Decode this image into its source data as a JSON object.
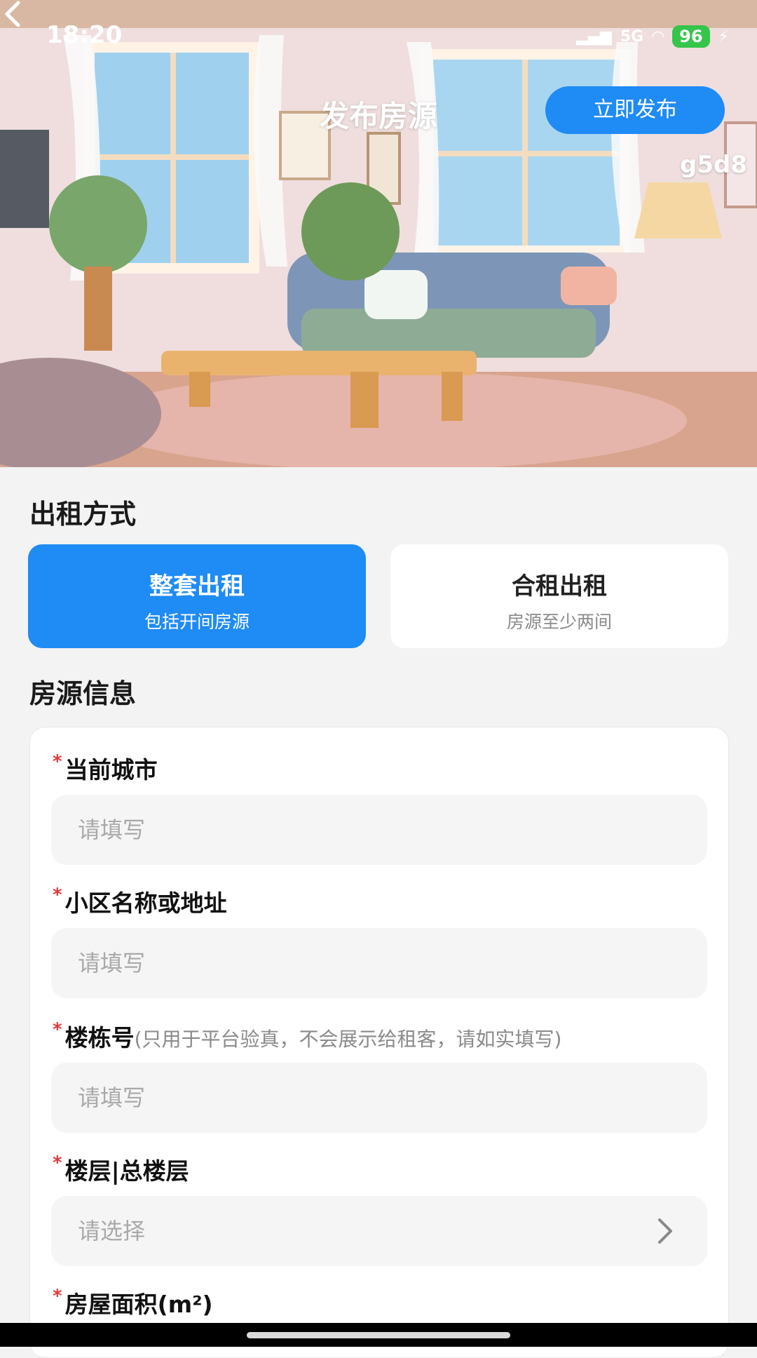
{
  "status_bar": {
    "time": "18:20",
    "network": "5G",
    "battery": "96"
  },
  "header": {
    "title": "发布房源",
    "publish_label": "立即发布",
    "watermark": "g5d8"
  },
  "rent_mode": {
    "section_title": "出租方式",
    "options": [
      {
        "title": "整套出租",
        "subtitle": "包括开间房源",
        "selected": true
      },
      {
        "title": "合租出租",
        "subtitle": "房源至少两间",
        "selected": false
      }
    ]
  },
  "info": {
    "section_title": "房源信息",
    "fields": [
      {
        "required_mark": "*",
        "label": "当前城市",
        "hint": "",
        "placeholder": "请填写"
      },
      {
        "required_mark": "*",
        "label": "小区名称或地址",
        "hint": "",
        "placeholder": "请填写"
      },
      {
        "required_mark": "*",
        "label": "楼栋号",
        "hint": "(只用于平台验真，不会展示给租客，请如实填写)",
        "placeholder": "请填写"
      },
      {
        "required_mark": "*",
        "label": "楼层|总楼层",
        "hint": "",
        "placeholder": "请选择"
      },
      {
        "required_mark": "*",
        "label": "房屋面积(m²)",
        "hint": ""
      }
    ]
  },
  "colors": {
    "accent": "#1f8bf5",
    "required": "#e4393c",
    "battery": "#35c54a"
  }
}
